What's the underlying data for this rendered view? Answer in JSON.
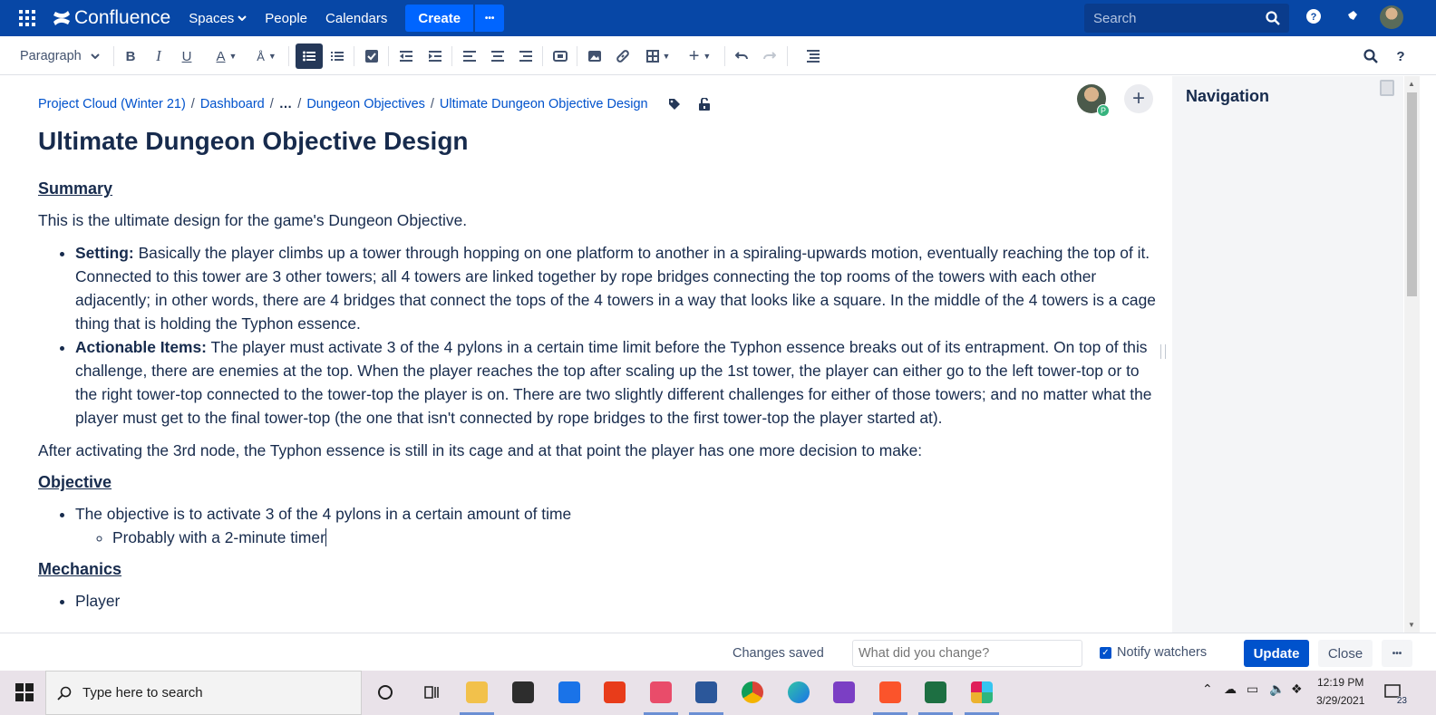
{
  "topnav": {
    "logo_text": "Confluence",
    "spaces": "Spaces",
    "people": "People",
    "calendars": "Calendars",
    "create": "Create",
    "more": "•••",
    "search_placeholder": "Search",
    "colors": {
      "bar": "#0747a6",
      "create": "#0065ff"
    }
  },
  "toolbar": {
    "style_select": "Paragraph",
    "icons": [
      "bold-icon",
      "italic-icon",
      "underline-icon",
      "text-color-icon",
      "text-format-icon",
      "bullet-list-icon",
      "numbered-list-icon",
      "task-icon",
      "outdent-icon",
      "indent-icon",
      "align-left-icon",
      "align-center-icon",
      "align-right-icon",
      "layout-icon",
      "image-icon",
      "link-icon",
      "table-icon",
      "insert-icon",
      "undo-icon",
      "redo-icon",
      "toc-icon",
      "find-icon",
      "help-icon"
    ]
  },
  "breadcrumb": {
    "items": [
      "Project Cloud (Winter 21)",
      "Dashboard",
      "…",
      "Dungeon Objectives",
      "Ultimate Dungeon Objective Design"
    ]
  },
  "page": {
    "title": "Ultimate Dungeon Objective Design",
    "avatar_badge": "P",
    "summary_heading": "Summary",
    "summary_intro": "This is the ultimate design for the game's Dungeon Objective.",
    "setting_label": "Setting:",
    "setting_text": " Basically the player climbs up a tower through hopping on one platform to another in a spiraling-upwards motion, eventually reaching the top of it. Connected to this tower are 3 other towers; all 4 towers are linked together by rope bridges connecting the top rooms of the towers with each other adjacently; in other words, there are 4 bridges that connect the tops of the 4 towers in a way that looks like a square. In the middle of the 4 towers is a cage thing that is holding the Typhon essence.",
    "actionable_label": "Actionable Items:",
    "actionable_text": " The player must activate 3 of the 4 pylons in a certain time limit before the Typhon essence breaks out of its entrapment. On top of this challenge, there are enemies at the top. When the player reaches the top after scaling up the 1st tower, the player can either go to the left tower-top or to the right tower-top connected to the tower-top the player is on. There are two slightly different challenges for either of those towers; and no matter what the player must get to the final tower-top (the one that isn't connected by rope bridges to the first tower-top the player started at).",
    "after_text": "After activating the 3rd node, the Typhon essence is still in its cage and at that point the player has one more decision to make:",
    "objective_heading": "Objective",
    "objective_item": "The objective is to activate 3 of the 4 pylons in a certain amount of time",
    "objective_subitem": "Probably with a 2-minute timer",
    "mechanics_heading": "Mechanics",
    "mechanics_item": "Player"
  },
  "navigation": {
    "title": "Navigation"
  },
  "footer": {
    "status": "Changes saved",
    "change_placeholder": "What did you change?",
    "notify_label": "Notify watchers",
    "notify_checked": true,
    "update": "Update",
    "close": "Close",
    "more": "•••"
  },
  "taskbar": {
    "search_placeholder": "Type here to search",
    "time": "12:19 PM",
    "date": "3/29/2021",
    "notification_count": "23"
  }
}
